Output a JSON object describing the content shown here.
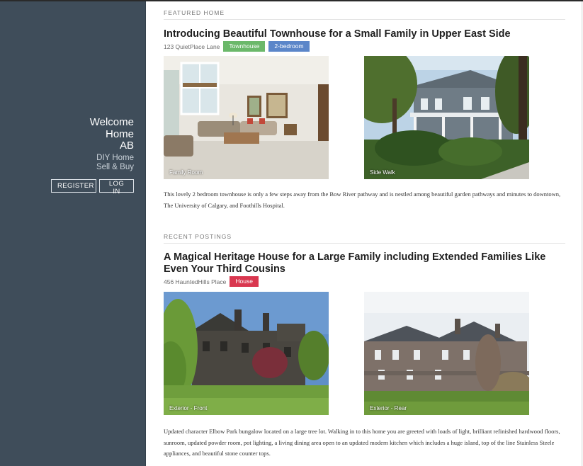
{
  "sidebar": {
    "brand_lines": [
      "Welcome",
      "Home",
      "AB"
    ],
    "tagline_lines": [
      "DIY Home",
      "Sell & Buy"
    ],
    "register_label": "REGISTER",
    "login_label": "LOG IN",
    "background_color": "#3f4d5a"
  },
  "featured": {
    "section_label": "FEATURED HOME",
    "title": "Introducing Beautiful Townhouse for a Small Family in Upper East Side",
    "address": "123 QuietPlace Lane",
    "tags": [
      {
        "label": "Townhouse",
        "color": "#6bb86a"
      },
      {
        "label": "2-bedroom",
        "color": "#5b86c9"
      }
    ],
    "photos": [
      {
        "caption": "Family Room"
      },
      {
        "caption": "Side Walk"
      }
    ],
    "description": "This lovely 2 bedroom townhouse is only a few steps away from the Bow River pathway and is nestled among beautiful garden pathways and minutes to downtown, The University of Calgary, and Foothills Hospital."
  },
  "recent": {
    "section_label": "RECENT POSTINGS",
    "title": "A Magical Heritage House for a Large Family including Extended Families Like Even Your Third Cousins",
    "address": "456 HauntedHills Place",
    "tags": [
      {
        "label": "House",
        "color": "#d9374f"
      }
    ],
    "photos": [
      {
        "caption": "Exterior - Front"
      },
      {
        "caption": "Exterior - Rear"
      }
    ],
    "description": "Updated character Elbow Park bungalow located on a large tree lot. Walking in to this home you are greeted with loads of light, brilliant refinished hardwood floors, sunroom, updated powder room, pot lighting, a living dining area open to an updated modern kitchen which includes a huge island, top of the line Stainless Steele appliances, and beautiful stone counter tops."
  }
}
